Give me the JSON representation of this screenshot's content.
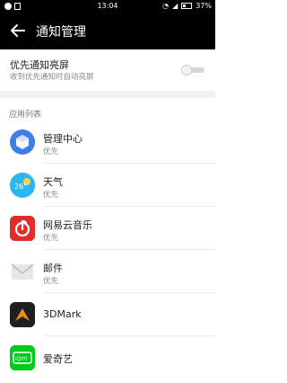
{
  "status_bar": {
    "time": "13:04",
    "battery": "37%",
    "left_icons": [
      "info-icon",
      "image-icon"
    ],
    "right_icons": [
      "wifi-icon",
      "signal-icon",
      "battery-icon"
    ]
  },
  "toolbar": {
    "title": "通知管理",
    "back_icon": "back-arrow-icon"
  },
  "priority_setting": {
    "title": "优先通知亮屏",
    "subtitle": "收到优先通知时自动亮屏",
    "enabled": false
  },
  "section": {
    "title": "应用列表"
  },
  "apps": [
    {
      "name": "管理中心",
      "priority": "优先",
      "icon": "manager-icon",
      "color": "#3f7ee8"
    },
    {
      "name": "天气",
      "priority": "优先",
      "icon": "weather-icon",
      "color": "#2ab6ee",
      "icon_text": "26°"
    },
    {
      "name": "网易云音乐",
      "priority": "优先",
      "icon": "netease-music-icon",
      "color": "#e12d29"
    },
    {
      "name": "邮件",
      "priority": "优先",
      "icon": "mail-icon",
      "color": "#d0d4d8"
    },
    {
      "name": "3DMark",
      "priority": "",
      "icon": "3dmark-icon",
      "color": "#1f1f1f"
    },
    {
      "name": "爱奇艺",
      "priority": "",
      "icon": "iqiyi-icon",
      "color": "#00c91f",
      "icon_text": "iQIYI"
    }
  ]
}
